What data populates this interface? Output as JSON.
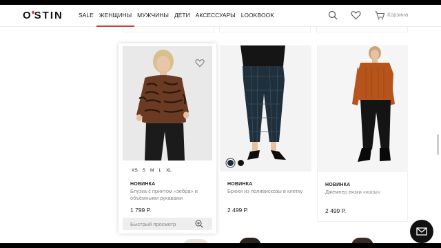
{
  "brand": {
    "logo": "O•STIN",
    "logo_left": "O",
    "logo_right": "STIN"
  },
  "nav": {
    "items": [
      {
        "label": "SALE"
      },
      {
        "label": "ЖЕНЩИНЫ",
        "active": true
      },
      {
        "label": "МУЖЧИНЫ"
      },
      {
        "label": "ДЕТИ"
      },
      {
        "label": "АКСЕССУАРЫ"
      },
      {
        "label": "LOOKBOOK"
      }
    ]
  },
  "header_actions": {
    "cart_label": "Корзина",
    "icons": [
      "search-icon",
      "heart-icon",
      "cart-icon"
    ]
  },
  "products": [
    {
      "badge": "НОВИНКА",
      "name": "Блузка с принтом «зебра» и объёмными рукавами",
      "price": "1 799 Р.",
      "sizes": [
        "XS",
        "S",
        "M",
        "L",
        "XL"
      ],
      "quick_view": "Быстрый просмотр"
    },
    {
      "badge": "НОВИНКА",
      "name": "Брюки из поливискозы в клетку",
      "price": "2 499 Р.",
      "swatches": [
        "#1f2b3a",
        "#111111"
      ]
    },
    {
      "badge": "НОВИНКА",
      "name": "Джемпер вязки «косы»",
      "price": "2 499 Р."
    }
  ],
  "colors": {
    "accent": "#d93a3a",
    "text": "#222222",
    "muted": "#888888"
  }
}
